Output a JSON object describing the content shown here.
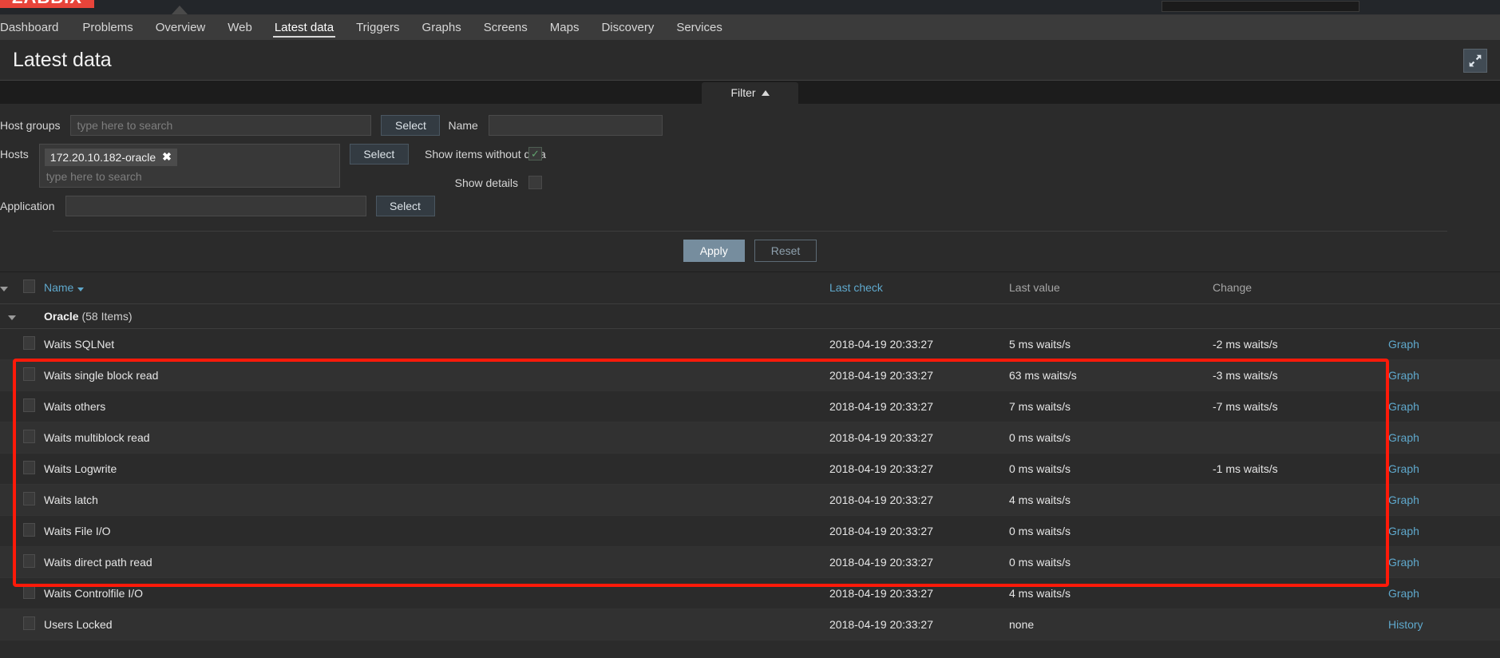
{
  "brand": {
    "logo_text": "ZABBIX"
  },
  "topnav": {
    "items": [
      {
        "label": "Dashboard",
        "active": false
      },
      {
        "label": "Problems",
        "active": false
      },
      {
        "label": "Overview",
        "active": false
      },
      {
        "label": "Web",
        "active": false
      },
      {
        "label": "Latest data",
        "active": true
      },
      {
        "label": "Triggers",
        "active": false
      },
      {
        "label": "Graphs",
        "active": false
      },
      {
        "label": "Screens",
        "active": false
      },
      {
        "label": "Maps",
        "active": false
      },
      {
        "label": "Discovery",
        "active": false
      },
      {
        "label": "Services",
        "active": false
      }
    ]
  },
  "page": {
    "title": "Latest data",
    "kiosk_icon": "expand-arrows-icon"
  },
  "filter": {
    "tab_label": "Filter",
    "tab_caret_icon": "caret-up-icon",
    "host_groups": {
      "label": "Host groups",
      "value": "",
      "placeholder": "type here to search",
      "select_label": "Select"
    },
    "hosts": {
      "label": "Hosts",
      "chips": [
        {
          "label": "172.20.10.182-oracle",
          "remove_icon": "close-icon"
        }
      ],
      "placeholder": "type here to search",
      "select_label": "Select"
    },
    "application": {
      "label": "Application",
      "value": "",
      "placeholder": "",
      "select_label": "Select"
    },
    "name": {
      "label": "Name",
      "value": "",
      "placeholder": ""
    },
    "show_items_without_data": {
      "label": "Show items without data",
      "checked": true,
      "check_glyph": "✓"
    },
    "show_details": {
      "label": "Show details",
      "checked": false,
      "check_glyph": ""
    },
    "apply_label": "Apply",
    "reset_label": "Reset"
  },
  "table": {
    "headers": {
      "name": "Name",
      "last_check": "Last check",
      "last_value": "Last value",
      "change": "Change"
    },
    "group": {
      "name": "Oracle",
      "count": "(58 Items)"
    },
    "rows": [
      {
        "name": "Waits SQLNet",
        "last_check": "2018-04-19 20:33:27",
        "last_value": "5 ms waits/s",
        "change": "-2 ms waits/s",
        "action": "Graph"
      },
      {
        "name": "Waits single block read",
        "last_check": "2018-04-19 20:33:27",
        "last_value": "63 ms waits/s",
        "change": "-3 ms waits/s",
        "action": "Graph"
      },
      {
        "name": "Waits others",
        "last_check": "2018-04-19 20:33:27",
        "last_value": "7 ms waits/s",
        "change": "-7 ms waits/s",
        "action": "Graph"
      },
      {
        "name": "Waits multiblock read",
        "last_check": "2018-04-19 20:33:27",
        "last_value": "0 ms waits/s",
        "change": "",
        "action": "Graph"
      },
      {
        "name": "Waits Logwrite",
        "last_check": "2018-04-19 20:33:27",
        "last_value": "0 ms waits/s",
        "change": "-1 ms waits/s",
        "action": "Graph"
      },
      {
        "name": "Waits latch",
        "last_check": "2018-04-19 20:33:27",
        "last_value": "4 ms waits/s",
        "change": "",
        "action": "Graph"
      },
      {
        "name": "Waits File I/O",
        "last_check": "2018-04-19 20:33:27",
        "last_value": "0 ms waits/s",
        "change": "",
        "action": "Graph"
      },
      {
        "name": "Waits direct path read",
        "last_check": "2018-04-19 20:33:27",
        "last_value": "0 ms waits/s",
        "change": "",
        "action": "Graph"
      },
      {
        "name": "Waits Controlfile I/O",
        "last_check": "2018-04-19 20:33:27",
        "last_value": "4 ms waits/s",
        "change": "",
        "action": "Graph"
      },
      {
        "name": "Users Locked",
        "last_check": "2018-04-19 20:33:27",
        "last_value": "none",
        "change": "",
        "action": "History"
      }
    ]
  },
  "annotation": {
    "color": "#ff1a09",
    "highlights_rows": "Waits SQLNet through Waits File I/O"
  }
}
